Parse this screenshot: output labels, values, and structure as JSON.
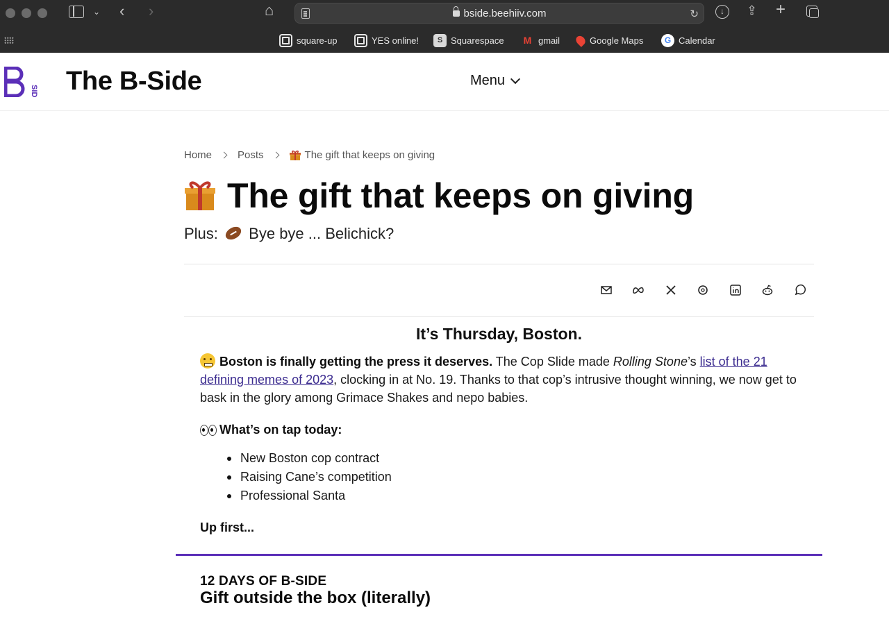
{
  "browser": {
    "url": "bside.beehiiv.com",
    "bookmarks": [
      {
        "label": "square-up",
        "icon": "square-logo-icon"
      },
      {
        "label": "YES online!",
        "icon": "square-logo-icon"
      },
      {
        "label": "Squarespace",
        "icon": "squarespace-icon"
      },
      {
        "label": "gmail",
        "icon": "gmail-icon"
      },
      {
        "label": "Google Maps",
        "icon": "google-maps-icon"
      },
      {
        "label": "Calendar",
        "icon": "google-icon"
      }
    ]
  },
  "site": {
    "title": "The B-Side",
    "menu_label": "Menu",
    "logo_colors": {
      "primary": "#5b2fb8"
    }
  },
  "breadcrumb": {
    "home": "Home",
    "posts": "Posts",
    "current": "The gift that keeps on giving"
  },
  "article": {
    "title": "The gift that keeps on giving",
    "subtitle_prefix": "Plus:",
    "subtitle_text": "Bye bye ... Belichick?",
    "share_icons": [
      "email-icon",
      "meta-icon",
      "x-icon",
      "threads-icon",
      "linkedin-icon",
      "reddit-icon",
      "whatsapp-icon"
    ],
    "greeting": "It’s Thursday, Boston.",
    "lead_bold": "Boston is finally getting the press it deserves.",
    "lead_text_1": " The Cop Slide made ",
    "lead_italic": "Rolling Stone",
    "lead_text_2": "’s ",
    "lead_link": "list of the 21 defining memes of 2023",
    "lead_text_3": ", clocking in at No. 19. Thanks to that cop’s intrusive thought winning, we now get to bask in the glory among Grimace Shakes and nepo babies.",
    "on_tap_label": "What’s on tap today:",
    "on_tap_items": [
      "New Boston cop contract",
      "Raising Cane’s competition",
      "Professional Santa"
    ],
    "up_first": "Up first...",
    "section_kicker": "12 DAYS OF B-SIDE",
    "section_title": "Gift outside the box (literally)"
  },
  "colors": {
    "accent": "#5b2fb8",
    "link": "#3b2b8f",
    "chrome_bg": "#2b2b2b"
  }
}
